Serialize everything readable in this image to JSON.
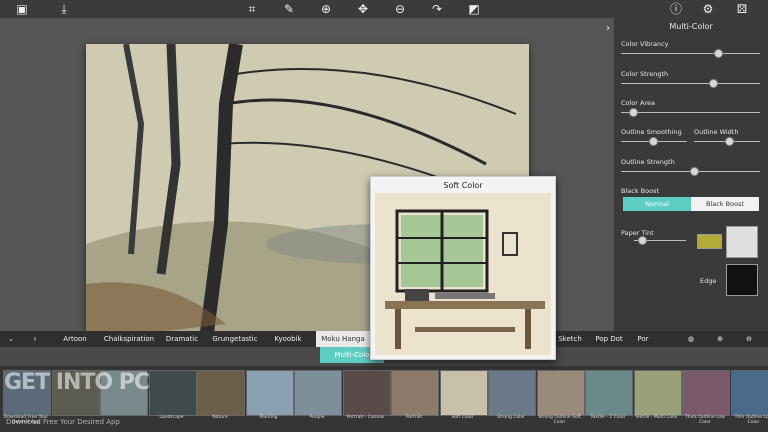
{
  "toolbar": {
    "icons": [
      "frame-icon",
      "save-icon",
      "crop-icon",
      "brush-icon",
      "zoom-in-icon",
      "move-icon",
      "zoom-out-icon",
      "redo-icon",
      "compare-icon",
      "info-icon",
      "settings-icon",
      "dice-icon"
    ]
  },
  "panel": {
    "title": "Multi-Color",
    "sliders": [
      {
        "label": "Color Vibrancy",
        "value": 0.78
      },
      {
        "label": "Color Strength",
        "value": 0.73
      },
      {
        "label": "Color Area",
        "value": 0.1
      },
      {
        "label": "Outline Smoothing",
        "value": 0.45
      },
      {
        "label": "Outline Width",
        "value": 0.6
      },
      {
        "label": "Outline Strength",
        "value": 0.55
      }
    ],
    "black_boost": {
      "label": "Black Boost",
      "options": [
        "Normal",
        "Black Boost"
      ],
      "selected": "Normal"
    },
    "paper_tint": {
      "label": "Paper Tint",
      "value": 0.1,
      "color": "#b3aa3a"
    },
    "edge_label": "Edge"
  },
  "styles": {
    "menu_label": "ı",
    "tabs": [
      "Artoon",
      "Chalkspiration",
      "Dramatic",
      "Grungetastic",
      "Kyoobik",
      "Moku Hanga",
      "Sketch",
      "Pop Dot",
      "Por"
    ],
    "active": "Moku Hanga",
    "subtab": "Multi-Colo",
    "actions": [
      "clipboard-icon",
      "add-icon",
      "remove-icon"
    ]
  },
  "popup": {
    "title": "Soft Color"
  },
  "thumbnails": [
    {
      "label": "Download Free Your Desired App"
    },
    {
      "label": ""
    },
    {
      "label": ""
    },
    {
      "label": "Landscape"
    },
    {
      "label": "Nature"
    },
    {
      "label": "Painting"
    },
    {
      "label": "People"
    },
    {
      "label": "Portrait - Canvas"
    },
    {
      "label": "Portrait"
    },
    {
      "label": "Soft Color"
    },
    {
      "label": "Strong Color"
    },
    {
      "label": "Strong Outline Soft Color"
    },
    {
      "label": "Textile - 2 Color"
    },
    {
      "label": "Textile - Multi Color"
    },
    {
      "label": "Thick Outline Low Color"
    },
    {
      "label": "Thin Outline Low Color"
    }
  ],
  "watermark": {
    "text": "GET INTO PC",
    "sub": "Download Free Your Desired App"
  }
}
